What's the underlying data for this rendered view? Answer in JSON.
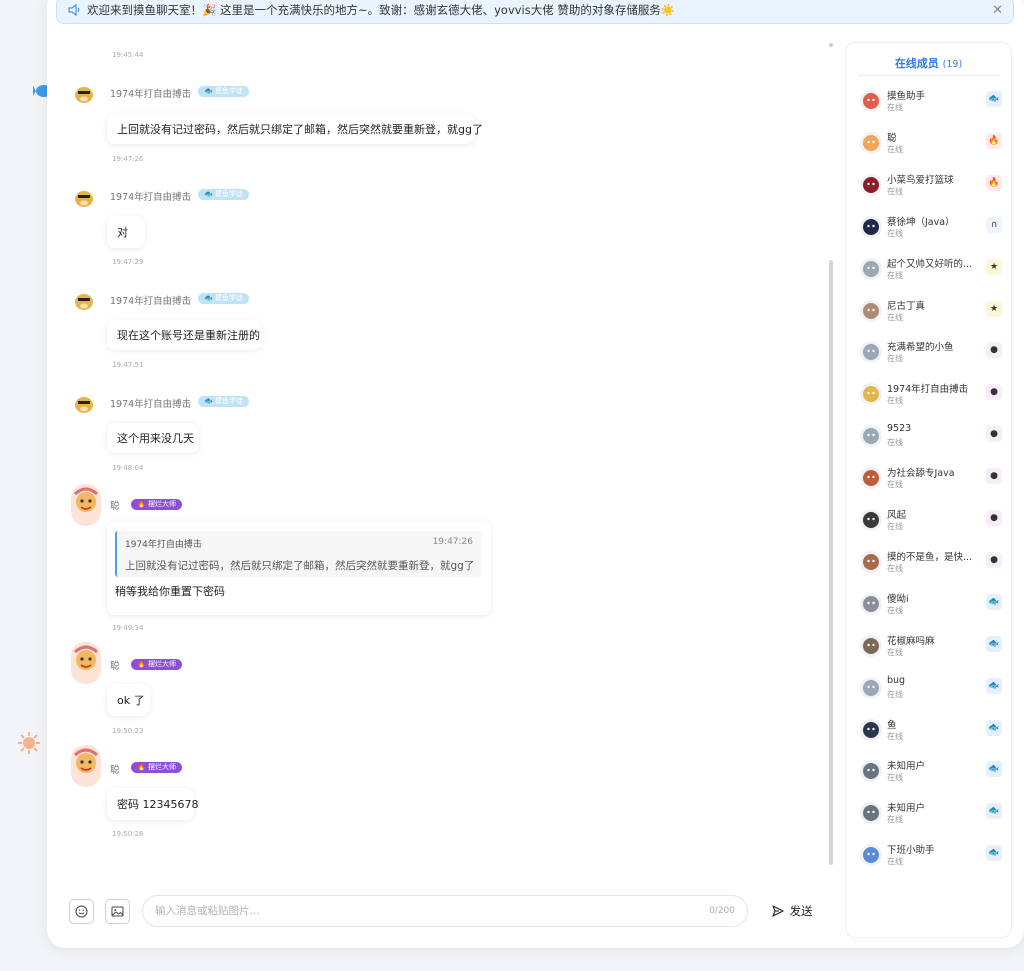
{
  "notice": {
    "text": "欢迎来到摸鱼聊天室！🎉 这里是一个充满快乐的地方~。致谢：感谢玄德大佬、yovvis大佬 赞助的对象存储服务☀️",
    "close": "✕"
  },
  "chat": {
    "top_timestamp": "19:45:44",
    "messages": [
      {
        "user": "1974年打自由搏击",
        "badge": "🐟 摸鱼学徒",
        "text": "上回就没有记过密码，然后就只绑定了邮箱，然后突然就要重新登，就gg了",
        "time": "19:47:26"
      },
      {
        "user": "1974年打自由搏击",
        "badge": "🐟 摸鱼学徒",
        "text": "对",
        "time": "19:47:29"
      },
      {
        "user": "1974年打自由搏击",
        "badge": "🐟 摸鱼学徒",
        "text": "现在这个账号还是重新注册的",
        "time": "19:47:51"
      },
      {
        "user": "1974年打自由搏击",
        "badge": "🐟 摸鱼学徒",
        "text": "这个用来没几天",
        "time": "19:48:04"
      },
      {
        "user": "聪",
        "badge": "🔥 摆烂大师",
        "quote_user": "1974年打自由搏击",
        "quote_time": "19:47:26",
        "quote_text": "上回就没有记过密码，然后就只绑定了邮箱，然后突然就要重新登，就gg了",
        "text": "稍等我给你重置下密码",
        "time": "19:49:34"
      },
      {
        "user": "聪",
        "badge": "🔥 摆烂大师",
        "text": "ok 了",
        "time": "19:50:23"
      },
      {
        "user": "聪",
        "badge": "🔥 摆烂大师",
        "text": "密码 12345678",
        "time": "19:50:26"
      }
    ]
  },
  "input": {
    "placeholder": "输入消息或粘贴图片...",
    "counter": "0/200",
    "send_label": "发送",
    "emoji_icon": "smile-icon",
    "image_icon": "image-icon"
  },
  "members": {
    "title": "在线成员",
    "count": "(19)",
    "list": [
      {
        "name": "摸鱼助手",
        "status": "在线",
        "color": "#e25b4b",
        "level": "🐟",
        "level_bg": "#e4f1fd"
      },
      {
        "name": "聪",
        "status": "在线",
        "color": "#f2a65a",
        "level": "🔥",
        "level_bg": "#fde8ee"
      },
      {
        "name": "小菜鸟爱打篮球",
        "status": "在线",
        "color": "#8a1f2b",
        "level": "🔥",
        "level_bg": "#fde8ee"
      },
      {
        "name": "蔡徐坤（Java）",
        "status": "在线",
        "color": "#1e2a4a",
        "level": "∩",
        "level_bg": "#eef5ff"
      },
      {
        "name": "起个又帅又好听的...",
        "status": "在线",
        "color": "#9aa7b5",
        "level": "★",
        "level_bg": "#fff6d8"
      },
      {
        "name": "尼古丁真",
        "status": "在线",
        "color": "#b08a74",
        "level": "★",
        "level_bg": "#fff6d8"
      },
      {
        "name": "充满希望的小鱼",
        "status": "在线",
        "color": "#9aa7b5",
        "level": "●",
        "level_bg": "#f6eef8"
      },
      {
        "name": "1974年打自由搏击",
        "status": "在线",
        "color": "#e5b54a",
        "level": "●",
        "level_bg": "#f6eef8"
      },
      {
        "name": "9523",
        "status": "在线",
        "color": "#9aa7b5",
        "level": "●",
        "level_bg": "#f6eef8"
      },
      {
        "name": "为社会舔专Java",
        "status": "在线",
        "color": "#c05a3a",
        "level": "●",
        "level_bg": "#f6eef8"
      },
      {
        "name": "风起",
        "status": "在线",
        "color": "#3a3a3a",
        "level": "●",
        "level_bg": "#f6eef8"
      },
      {
        "name": "摸的不是鱼，是快...",
        "status": "在线",
        "color": "#a86b4a",
        "level": "●",
        "level_bg": "#f6eef8"
      },
      {
        "name": "傻呦i",
        "status": "在线",
        "color": "#8a8f99",
        "level": "🐟",
        "level_bg": "#e4f1fd"
      },
      {
        "name": "花椒麻吗麻",
        "status": "在线",
        "color": "#7a6a55",
        "level": "🐟",
        "level_bg": "#e4f1fd"
      },
      {
        "name": "bug",
        "status": "在线",
        "color": "#9aa7b5",
        "level": "🐟",
        "level_bg": "#e4f1fd"
      },
      {
        "name": "鱼",
        "status": "在线",
        "color": "#2a3550",
        "level": "🐟",
        "level_bg": "#e4f1fd"
      },
      {
        "name": "未知用户",
        "status": "在线",
        "color": "#6a7380",
        "level": "🐟",
        "level_bg": "#e4f1fd"
      },
      {
        "name": "未知用户",
        "status": "在线",
        "color": "#6a7380",
        "level": "🐟",
        "level_bg": "#e4f1fd"
      },
      {
        "name": "下班小助手",
        "status": "在线",
        "color": "#5a8ad8",
        "level": "🐟",
        "level_bg": "#e4f1fd"
      }
    ]
  }
}
